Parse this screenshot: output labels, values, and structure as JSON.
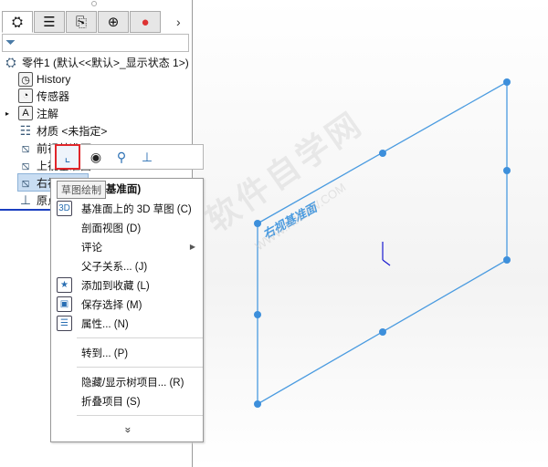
{
  "tree": {
    "root": "零件1  (默认<<默认>_显示状态 1>)",
    "items": [
      "History",
      "传感器",
      "注解",
      "材质 <未指定>",
      "前视基准面",
      "上视基准面",
      "右视基准面",
      "原点"
    ],
    "visible_prefixes": [
      "前",
      "上",
      "右初",
      "原点"
    ]
  },
  "tabs": [
    "feature-manager",
    "property-manager",
    "configuration-manager",
    "dimxpert-manager",
    "display-manager"
  ],
  "context_toolbar": {
    "tooltip": "草图绘制"
  },
  "menu": {
    "header": "(右视基准面)",
    "items": [
      {
        "label": "基准面上的 3D 草图 (C)",
        "icon": "3d-sketch-icon"
      },
      {
        "label": "剖面视图 (D)"
      },
      {
        "label": "评论",
        "submenu": true
      },
      {
        "label": "父子关系... (J)"
      },
      {
        "label": "添加到收藏 (L)",
        "icon": "favorite-icon"
      },
      {
        "label": "保存选择 (M)",
        "icon": "save-selection-icon"
      },
      {
        "label": "属性... (N)",
        "icon": "properties-icon"
      },
      {
        "label": "转到... (P)"
      },
      {
        "label": "隐藏/显示树项目... (R)"
      },
      {
        "label": "折叠项目 (S)"
      }
    ],
    "more": "»"
  },
  "viewport": {
    "plane_label": "右视基准面",
    "plane_color": "#4a9be0"
  },
  "watermark": {
    "text": "软件自学网",
    "url": "WWW.RJZXW.COM"
  }
}
